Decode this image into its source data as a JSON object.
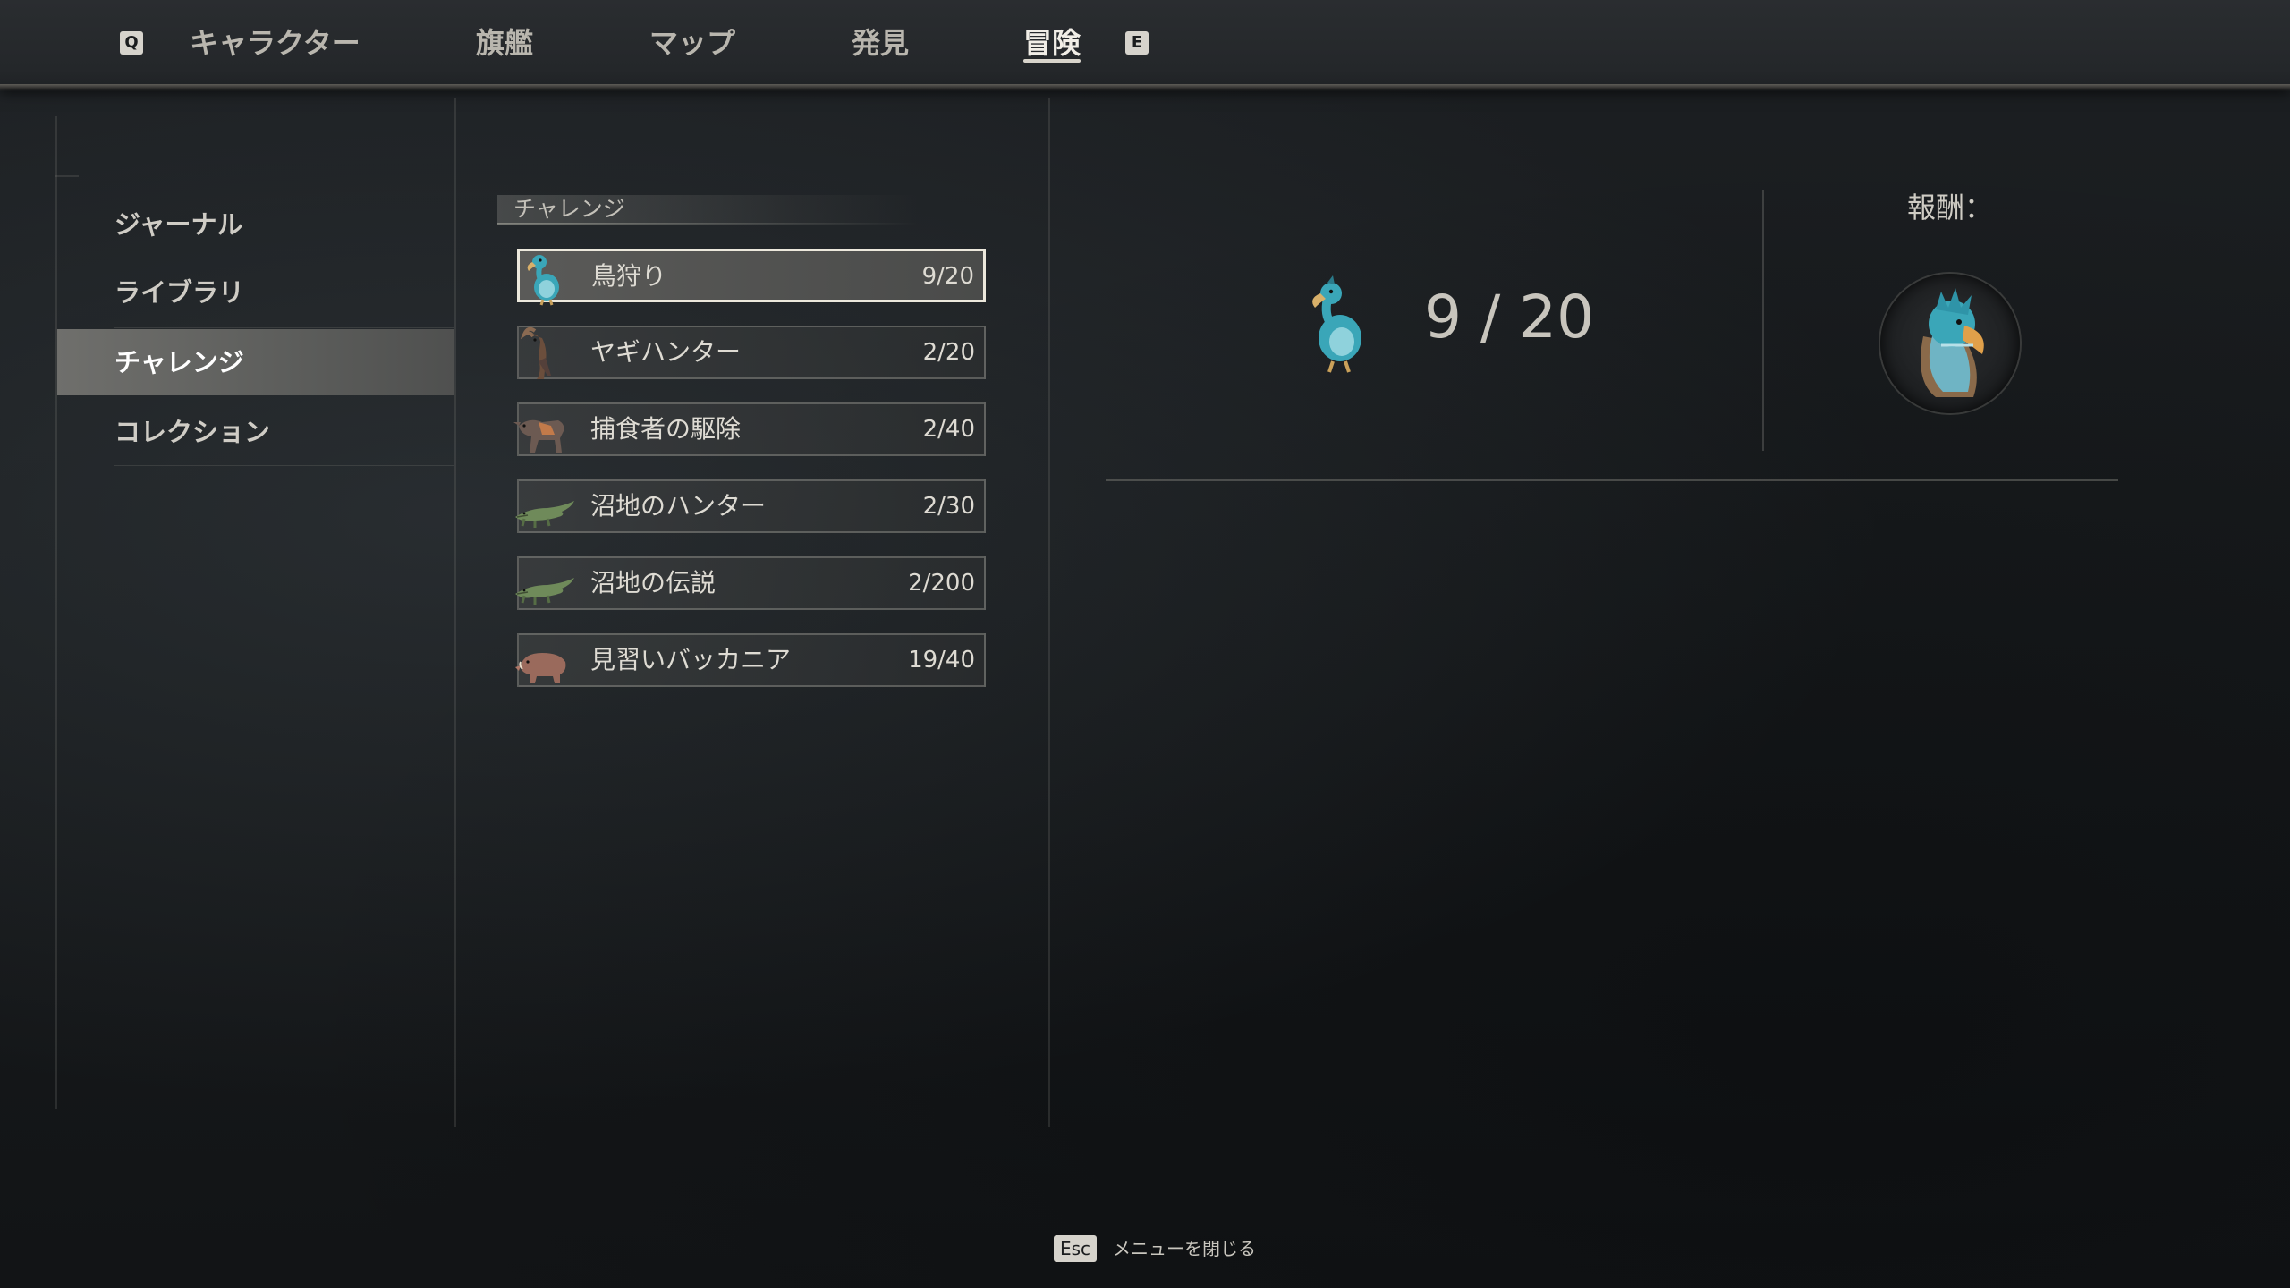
{
  "nav": {
    "prev_key": "Q",
    "next_key": "E",
    "tabs": [
      {
        "label": "キャラクター",
        "active": false
      },
      {
        "label": "旗艦",
        "active": false
      },
      {
        "label": "マップ",
        "active": false
      },
      {
        "label": "発見",
        "active": false
      },
      {
        "label": "冒険",
        "active": true
      }
    ]
  },
  "sidebar": {
    "items": [
      {
        "label": "ジャーナル",
        "active": false
      },
      {
        "label": "ライブラリ",
        "active": false
      },
      {
        "label": "チャレンジ",
        "active": true
      },
      {
        "label": "コレクション",
        "active": false
      }
    ]
  },
  "challenges": {
    "title": "チャレンジ",
    "items": [
      {
        "label": "鳥狩り",
        "count": "9/20",
        "icon": "dodo-icon",
        "selected": true
      },
      {
        "label": "ヤギハンター",
        "count": "2/20",
        "icon": "goat-icon",
        "selected": false
      },
      {
        "label": "捕食者の駆除",
        "count": "2/40",
        "icon": "wolf-icon",
        "selected": false
      },
      {
        "label": "沼地のハンター",
        "count": "2/30",
        "icon": "crocodile-icon",
        "selected": false
      },
      {
        "label": "沼地の伝説",
        "count": "2/200",
        "icon": "crocodile-icon",
        "selected": false
      },
      {
        "label": "見習いバッカニア",
        "count": "19/40",
        "icon": "boar-icon",
        "selected": false
      }
    ]
  },
  "detail": {
    "progress_text": "9 / 20",
    "progress_value": 9,
    "progress_max": 20,
    "icon": "dodo-icon",
    "reward_label": "報酬：",
    "reward_icon": "dodo-trophy-icon"
  },
  "footer": {
    "key": "Esc",
    "label": "メニューを閉じる"
  },
  "colors": {
    "background": "#151719",
    "text": "#c9c6c0",
    "selected_border": "#ece8dc",
    "dodo_blue": "#3aa6b8"
  }
}
